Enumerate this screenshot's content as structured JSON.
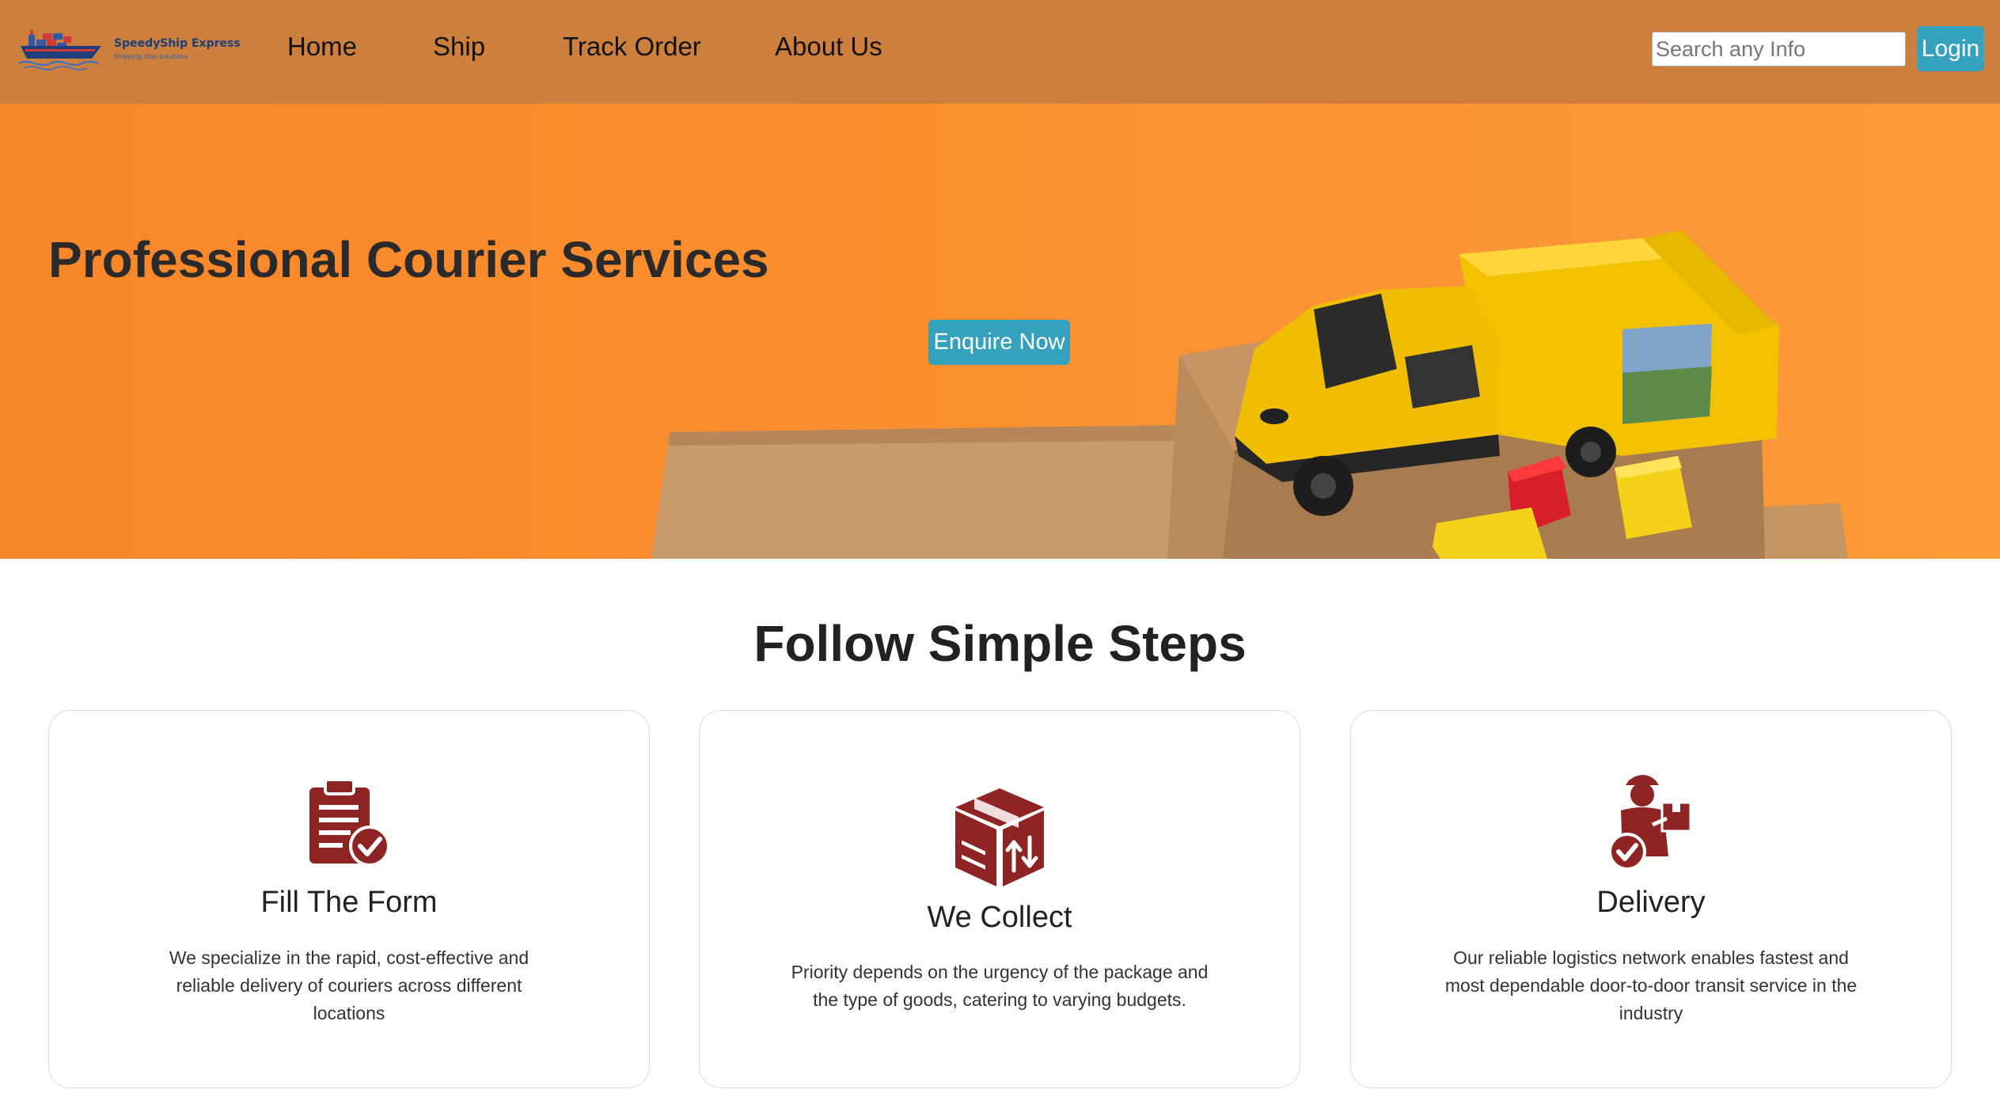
{
  "brand": {
    "name": "SpeedyShip Express",
    "tagline": "Shipping stop solutions",
    "logo_icon": "cargo-ship-icon"
  },
  "nav": {
    "items": [
      {
        "label": "Home"
      },
      {
        "label": "Ship"
      },
      {
        "label": "Track Order"
      },
      {
        "label": "About Us"
      }
    ],
    "search_placeholder": "Search any Info",
    "login_label": "Login"
  },
  "hero": {
    "title": "Professional Courier Services",
    "cta_label": "Enquire Now"
  },
  "steps": {
    "title": "Follow Simple Steps",
    "items": [
      {
        "icon": "clipboard-check-icon",
        "title": "Fill The Form",
        "description": "We specialize in the rapid, cost-effective and reliable delivery of couriers across different locations"
      },
      {
        "icon": "package-exchange-icon",
        "title": "We Collect",
        "description": "Priority depends on the urgency of the package and the type of goods, catering to varying budgets."
      },
      {
        "icon": "delivery-person-icon",
        "title": "Delivery",
        "description": "Our reliable logistics network enables fastest and most dependable door-to-door transit service in the industry"
      }
    ]
  },
  "colors": {
    "navbar_bg": "#cd7f3e",
    "hero_bg": "#fb8f2e",
    "button_bg": "#35a2bd",
    "icon_color": "#8f2424"
  }
}
